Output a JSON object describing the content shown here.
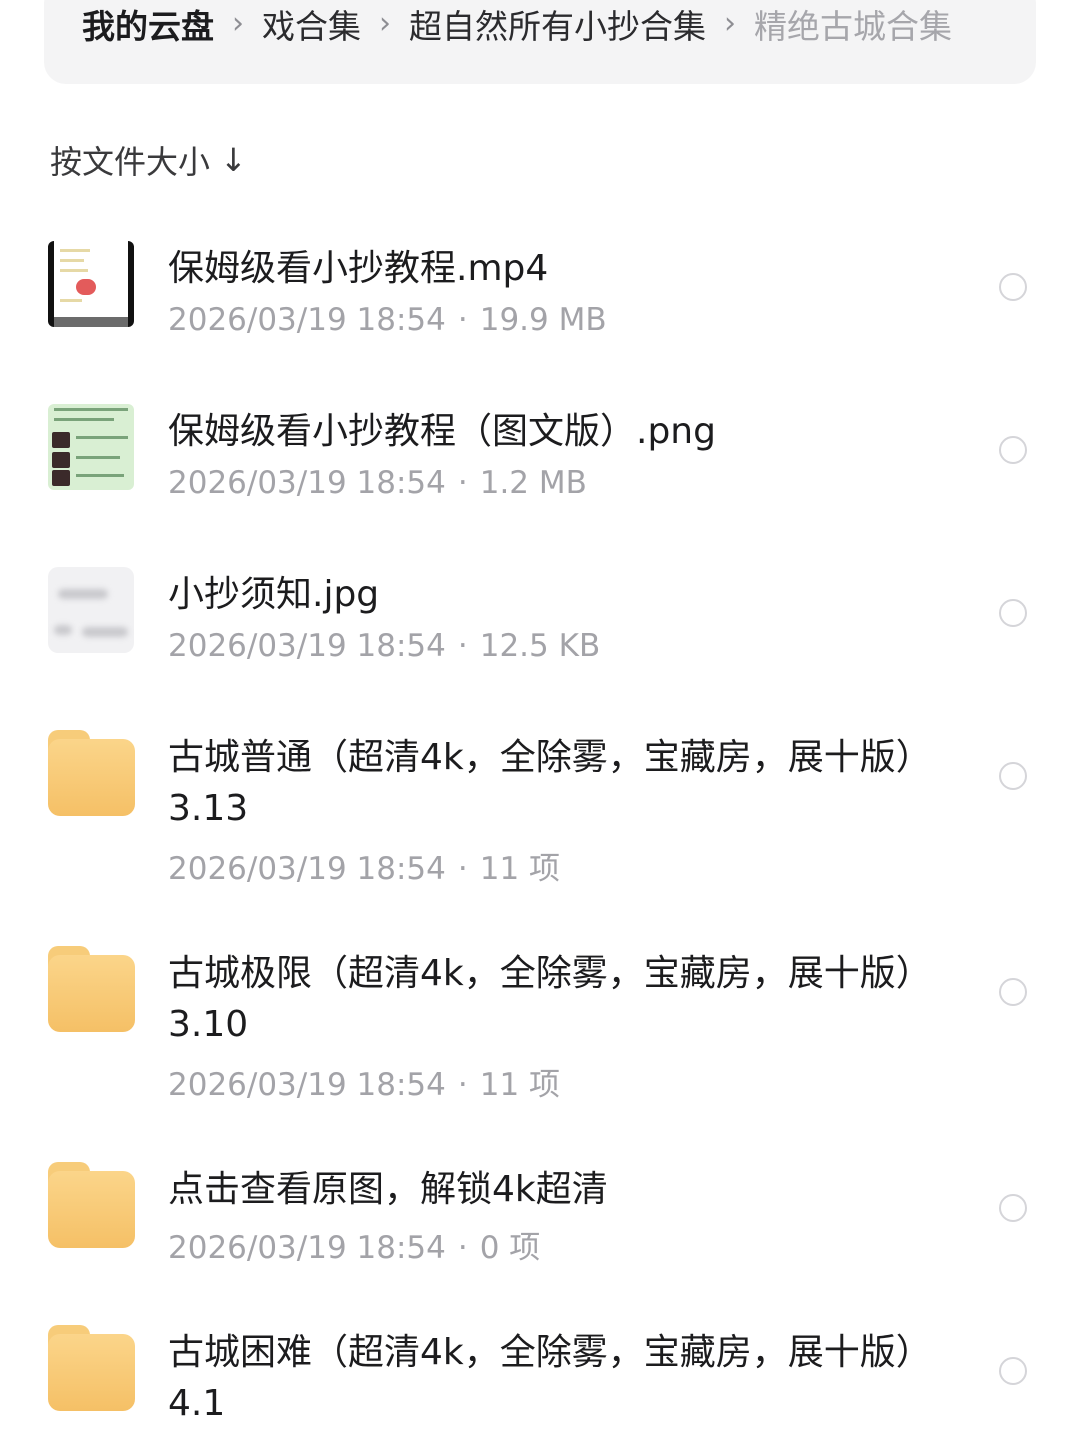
{
  "breadcrumb": {
    "items": [
      "我的云盘",
      "戏合集",
      "超自然所有小抄合集",
      "精绝古城合集"
    ],
    "separator": "›"
  },
  "sort": {
    "label": "按文件大小",
    "arrow": "↓"
  },
  "files": [
    {
      "name": "保姆级看小抄教程.mp4",
      "date": "2026/03/19 18:54",
      "info": "19.9 MB",
      "type": "video"
    },
    {
      "name": "保姆级看小抄教程（图文版）.png",
      "date": "2026/03/19 18:54",
      "info": "1.2 MB",
      "type": "image"
    },
    {
      "name": "小抄须知.jpg",
      "date": "2026/03/19 18:54",
      "info": "12.5 KB",
      "type": "image"
    },
    {
      "name": "古城普通（超清4k，全除雾，宝藏房，展十版）3.13",
      "date": "2026/03/19 18:54",
      "info": "11 项",
      "type": "folder"
    },
    {
      "name": "古城极限（超清4k，全除雾，宝藏房，展十版）3.10",
      "date": "2026/03/19 18:54",
      "info": "11 项",
      "type": "folder"
    },
    {
      "name": "点击查看原图，解锁4k超清",
      "date": "2026/03/19 18:54",
      "info": "0 项",
      "type": "folder"
    },
    {
      "name": "古城困难（超清4k，全除雾，宝藏房，展十版）4.1",
      "type": "folder"
    }
  ],
  "meta_separator": "·",
  "colors": {
    "folder": "#f7c772",
    "meta_text": "#a3a3a8",
    "breadcrumb_bg": "#f4f4f5",
    "radio_border": "#d5d5d9"
  }
}
